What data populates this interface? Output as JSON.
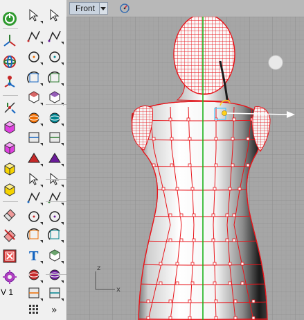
{
  "viewport": {
    "view_name": "Front",
    "axis_labels": {
      "z": "z",
      "x": "x"
    }
  },
  "status": {
    "version_label": "V 1"
  },
  "colors": {
    "viewport_bg": "#a6a6a6",
    "grid_minor": "#9c9c9c",
    "grid_major": "#8e8e8e",
    "mesh": "#e8141a",
    "y_axis": "#19b219",
    "x_axis_gizmo": "#d94040",
    "toolbar_bg": "#f0f0f0",
    "view_tab": "#c9d3df"
  },
  "toolbar": {
    "left": [
      "rhino-logo-icon",
      "cplane-icon",
      "gumball-icon",
      "osnap-axis-icon",
      "cage-point-icon",
      "move-box-icon",
      "pink-box-icon",
      "pink-box-edit-icon",
      "yellow-box-icon",
      "yellow-box-2-icon",
      "eraser-icon",
      "delete-icon",
      "record-history-icon",
      "options-icon"
    ],
    "right": [
      "select-icon",
      "point-icon",
      "polyline-icon",
      "curve-icon",
      "circle-icon",
      "ellipse-icon",
      "arc-icon",
      "rectangle-icon",
      "polygon-icon",
      "fillet-curve-icon",
      "offset-icon",
      "surface-icon",
      "box-icon",
      "sphere-icon",
      "cylinder-icon",
      "mesh-icon",
      "extrude-icon",
      "boolean-icon",
      "transform-icon",
      "dimension-icon",
      "analyze-icon",
      "render-icon",
      "blend-curve-icon",
      "curve-tools-icon",
      "text-icon",
      "split-icon",
      "layer-icon",
      "measure-icon",
      "block-icon",
      "array-icon",
      "grid-icon",
      "more-icon"
    ]
  }
}
